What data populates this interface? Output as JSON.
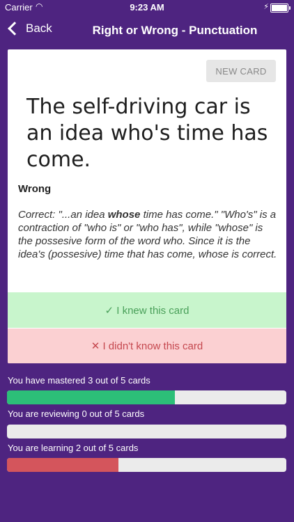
{
  "status_bar": {
    "carrier": "Carrier",
    "time": "9:23 AM"
  },
  "nav": {
    "back_label": "Back",
    "title": "Right or Wrong - Punctuation"
  },
  "card": {
    "new_card_label": "NEW CARD",
    "question": "The self-driving car is an idea who's time has come.",
    "verdict": "Wrong",
    "explanation_pre": "Correct: \"...an idea ",
    "explanation_em": "whose",
    "explanation_post": " time has come.\" \"Who's\" is a contraction of \"who is\" or \"who has\", while \"whose\" is the possesive form of the word who. Since it is the idea's (possesive) time that has come, whose is correct.",
    "knew_label": "✓ I knew this card",
    "didnt_label": "✕ I didn't know this card"
  },
  "progress": {
    "mastered": {
      "text": "You have mastered 3 out of 5 cards",
      "fraction": 0.6
    },
    "reviewing": {
      "text": "You are reviewing 0 out of 5 cards",
      "fraction": 0
    },
    "learning": {
      "text": "You are learning 2 out of 5 cards",
      "fraction": 0.4
    }
  }
}
